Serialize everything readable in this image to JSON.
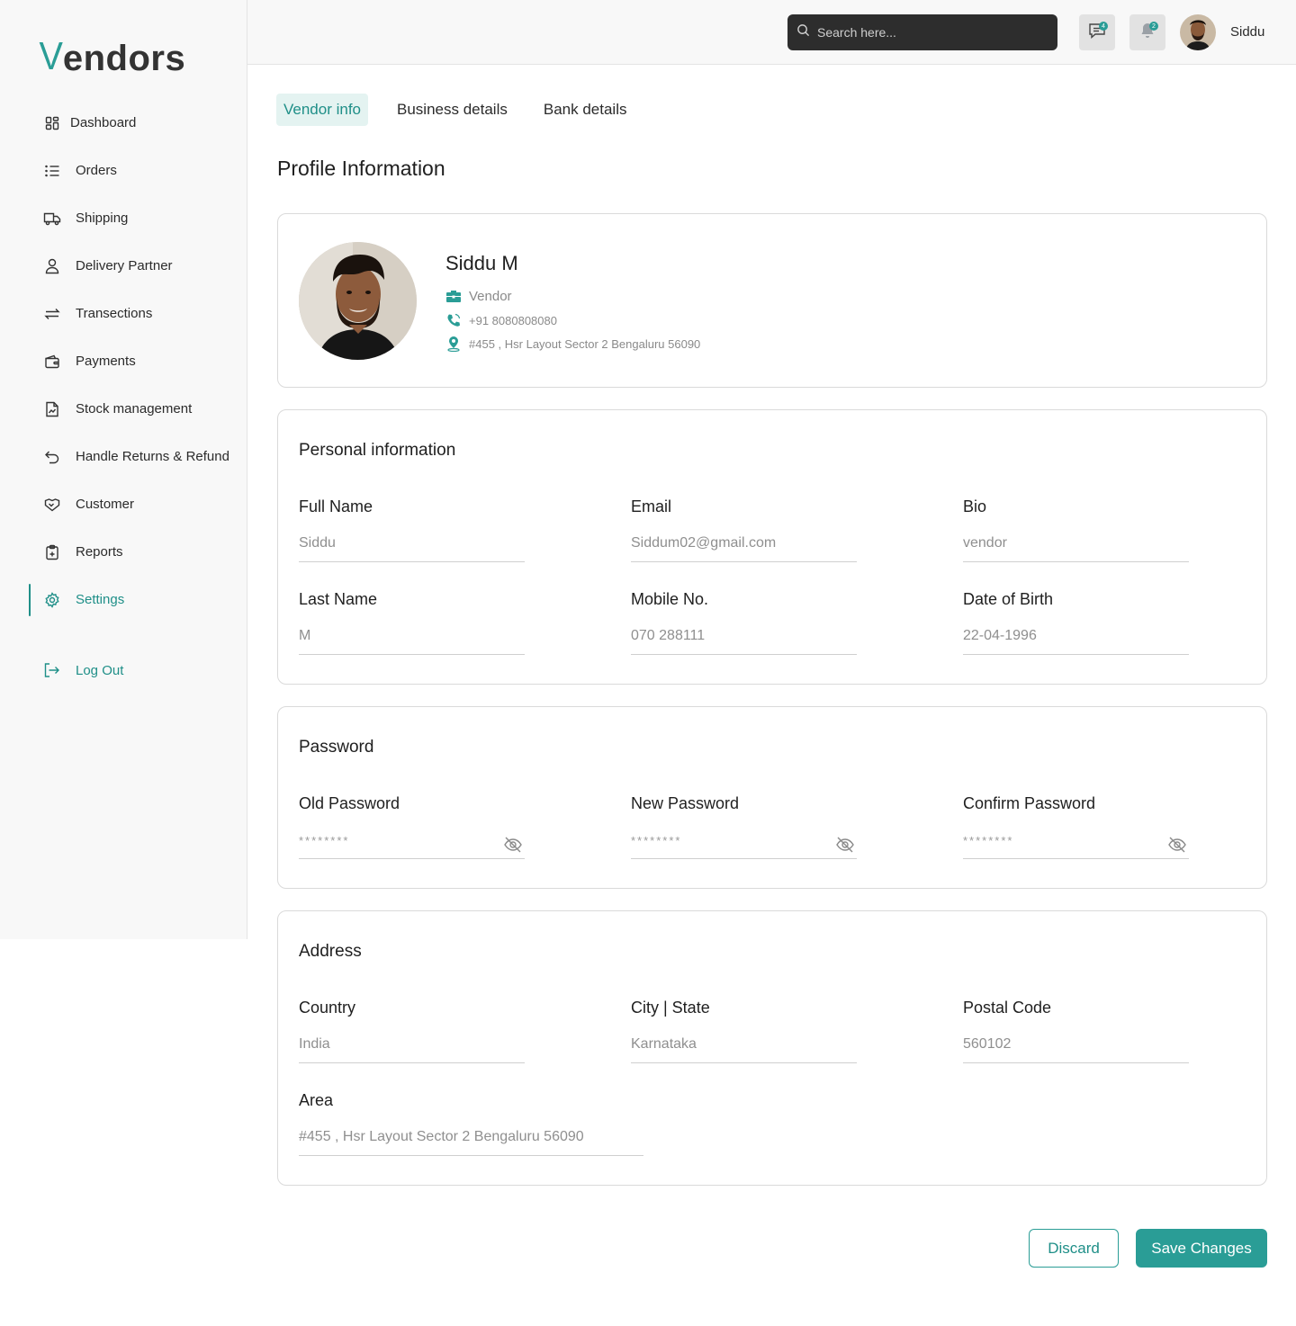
{
  "brand": {
    "logo_v": "V",
    "logo_rest": "endors",
    "accent": "#2a9d96"
  },
  "sidebar": {
    "items": [
      {
        "label": "Dashboard",
        "icon": "dashboard-icon"
      },
      {
        "label": "Orders",
        "icon": "list-icon"
      },
      {
        "label": "Shipping",
        "icon": "truck-icon"
      },
      {
        "label": "Delivery Partner",
        "icon": "user-icon"
      },
      {
        "label": "Transections",
        "icon": "swap-icon"
      },
      {
        "label": "Payments",
        "icon": "wallet-icon"
      },
      {
        "label": "Stock management",
        "icon": "stock-report-icon"
      },
      {
        "label": "Handle Returns & Refund",
        "icon": "return-icon"
      },
      {
        "label": "Customer",
        "icon": "handshake-icon"
      },
      {
        "label": "Reports",
        "icon": "clipboard-icon"
      },
      {
        "label": "Settings",
        "icon": "gear-icon",
        "active": true
      }
    ],
    "logout": "Log Out"
  },
  "header": {
    "search_placeholder": "Search here...",
    "messages_badge": "4",
    "notifications_badge": "2",
    "user_name": "Siddu"
  },
  "tabs": [
    "Vendor info",
    "Business details",
    "Bank details"
  ],
  "page_title": "Profile Information",
  "profile": {
    "name": "Siddu M",
    "role": "Vendor",
    "phone": "+91 8080808080",
    "address": "#455 , Hsr Layout Sector 2 Bengaluru 56090"
  },
  "personal": {
    "title": "Personal information",
    "full_name": {
      "label": "Full Name",
      "value": "Siddu"
    },
    "email": {
      "label": "Email",
      "value": "Siddum02@gmail.com"
    },
    "bio": {
      "label": "Bio",
      "value": "vendor"
    },
    "last_name": {
      "label": "Last Name",
      "value": "M"
    },
    "mobile": {
      "label": "Mobile No.",
      "value": "070 288111"
    },
    "dob": {
      "label": "Date of Birth",
      "value": "22-04-1996"
    }
  },
  "password": {
    "title": "Password",
    "old": {
      "label": "Old Password",
      "value": "********"
    },
    "new": {
      "label": "New Password",
      "value": "********"
    },
    "confirm": {
      "label": "Confirm Password",
      "value": "********"
    }
  },
  "address": {
    "title": "Address",
    "country": {
      "label": "Country",
      "value": "India"
    },
    "city_state": {
      "label": "City | State",
      "value": "Karnataka"
    },
    "postal": {
      "label": "Postal Code",
      "value": "560102"
    },
    "area": {
      "label": "Area",
      "value": "#455 , Hsr Layout Sector 2 Bengaluru 56090"
    }
  },
  "actions": {
    "discard": "Discard",
    "save": "Save Changes"
  }
}
